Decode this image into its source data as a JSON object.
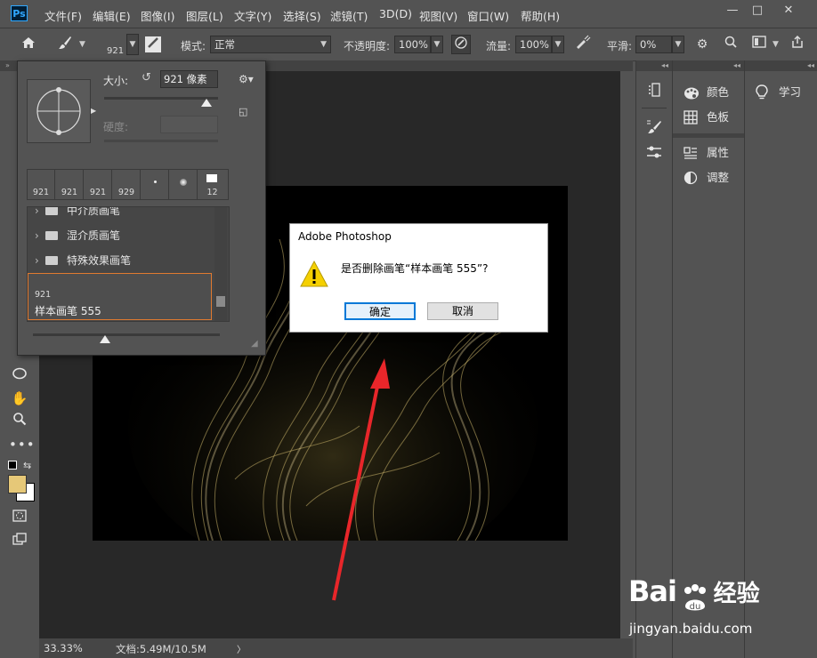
{
  "app": {
    "logo": "Ps"
  },
  "menu": [
    "文件(F)",
    "编辑(E)",
    "图像(I)",
    "图层(L)",
    "文字(Y)",
    "选择(S)",
    "滤镜(T)",
    "3D(D)",
    "视图(V)",
    "窗口(W)",
    "帮助(H)"
  ],
  "window_controls": {
    "minimize": "—",
    "maximize": "□",
    "close": "✕"
  },
  "options": {
    "brush_size": "921",
    "mode_label": "模式:",
    "mode_value": "正常",
    "opacity_label": "不透明度:",
    "opacity_value": "100%",
    "flow_label": "流量:",
    "flow_value": "100%",
    "smooth_label": "平滑:",
    "smooth_value": "0%"
  },
  "brush_popup": {
    "size_label": "大小:",
    "size_value": "921 像素",
    "hardness_label": "硬度:",
    "presets": [
      "921",
      "921",
      "921",
      "929",
      "",
      "",
      "12"
    ],
    "folders": [
      "中介质画笔",
      "湿介质画笔",
      "特殊效果画笔"
    ],
    "selected_brush_size": "921",
    "selected_brush_name": "样本画笔 555"
  },
  "dialog": {
    "title": "Adobe Photoshop",
    "message": "是否删除画笔“样本画笔 555”?",
    "ok_label": "确定",
    "cancel_label": "取消"
  },
  "panels": {
    "color": "颜色",
    "swatches": "色板",
    "properties": "属性",
    "adjustments": "调整",
    "learn": "学习"
  },
  "status": {
    "zoom": "33.33%",
    "doc_info": "文档:5.49M/10.5M",
    "arrow": "〉"
  },
  "colors": {
    "foreground": "#e6c878",
    "background": "#ffffff",
    "accent_arrow": "#e8262a"
  },
  "watermark": {
    "brand": "Bai",
    "brand2": "经验",
    "url": "jingyan.baidu.com"
  }
}
